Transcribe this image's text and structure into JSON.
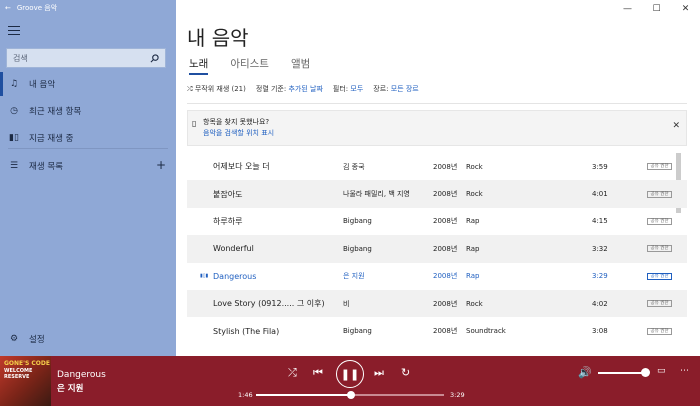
{
  "app": {
    "title": "Groove 음악"
  },
  "window": {
    "minimize": "—",
    "maximize": "☐",
    "close": "✕"
  },
  "sidebar": {
    "search_placeholder": "검색",
    "items": [
      {
        "label": "내 음악",
        "icon": "music-note-icon",
        "glyph": "♫"
      },
      {
        "label": "최근 재생 항목",
        "icon": "clock-icon",
        "glyph": "◷"
      },
      {
        "label": "지금 재생 중",
        "icon": "now-playing-icon",
        "glyph": "▮▯"
      },
      {
        "label": "재생 목록",
        "icon": "playlist-icon",
        "glyph": "☰"
      }
    ],
    "add_glyph": "+",
    "settings": "설정"
  },
  "main": {
    "heading": "내 음악",
    "tabs": [
      "노래",
      "아티스트",
      "앨범"
    ],
    "filters": {
      "shuffle": "무작위 재생 (21)",
      "sort_label": "정렬 기준:",
      "sort_value": "추가된 날짜",
      "filter_label": "필터:",
      "filter_value": "모두",
      "genre_label": "장르:",
      "genre_value": "모든 장르"
    },
    "notice": {
      "title": "항목을 찾지 못했나요?",
      "link": "음악을 검색할 위치 표시"
    },
    "songs": [
      {
        "title": "어제보다 오늘 더",
        "artist": "김 종국",
        "year": "2008년",
        "genre": "Rock",
        "duration": "3:59",
        "badge": "공유 권한"
      },
      {
        "title": "붙잡아도",
        "artist": "나울라 패밀리, 백 지영",
        "year": "2008년",
        "genre": "Rock",
        "duration": "4:01",
        "badge": "공유 권한"
      },
      {
        "title": "하루하루",
        "artist": "Bigbang",
        "year": "2008년",
        "genre": "Rap",
        "duration": "4:15",
        "badge": "공유 권한"
      },
      {
        "title": "Wonderful",
        "artist": "Bigbang",
        "year": "2008년",
        "genre": "Rap",
        "duration": "3:32",
        "badge": "공유 권한"
      },
      {
        "title": "Dangerous",
        "artist": "은 지원",
        "year": "2008년",
        "genre": "Rap",
        "duration": "3:29",
        "badge": "공유 권한",
        "playing": true
      },
      {
        "title": "Love Story (0912..... 그 이후)",
        "artist": "비",
        "year": "2008년",
        "genre": "Rock",
        "duration": "4:02",
        "badge": "공유 권한"
      },
      {
        "title": "Stylish (The Fila)",
        "artist": "Bigbang",
        "year": "2008년",
        "genre": "Soundtrack",
        "duration": "3:08",
        "badge": "공유 권한"
      }
    ]
  },
  "player": {
    "title": "Dangerous",
    "artist": "은 지원",
    "album_art_text": "GONE'S CODE",
    "album_art_subtext": "WELCOME RESERVE",
    "current_time": "1:46",
    "total_time": "3:29",
    "progress": 0.507,
    "volume": 0.85
  }
}
